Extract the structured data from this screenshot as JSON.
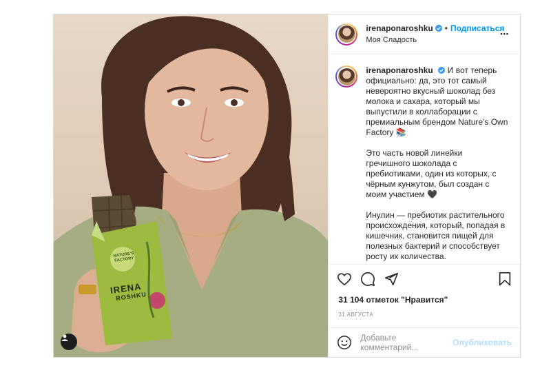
{
  "header": {
    "username": "irenaponaroshku",
    "separator": "•",
    "follow_label": "Подписаться",
    "location": "Моя Сладость",
    "more": "•••"
  },
  "caption": {
    "username": "irenaponaroshku",
    "paragraphs": [
      "И вот теперь официально: да, это тот самый невероятно вкусный шоколад без молока и сахара, который мы выпустили в коллаборации с премиальным брендом Nature's Own Factory 📚",
      "Это часть новой линейки гречишного шоколада с пребиотиками, один из которых, с чёрным кунжутом, был создан с моим участием 🖤",
      "Инулин — пребиотик растительного происхождения, который, попадая в кишечник, становится пищей для полезных бактерий и способствует росту их количества."
    ]
  },
  "photo": {
    "package_brand": "NATURE'S FACTORY",
    "package_name_1": "IRENA",
    "package_name_2": "ROSHKU"
  },
  "likes": "31 104 отметок \"Нравится\"",
  "date": "31 АВГУСТА",
  "comment": {
    "placeholder": "Добавьте комментарий...",
    "publish_label": "Опубликовать"
  },
  "icons": [
    "user-tag-icon",
    "heart-icon",
    "comment-icon",
    "share-icon",
    "bookmark-icon",
    "emoji-icon",
    "verified-icon",
    "more-icon"
  ],
  "colors": {
    "accent": "#0095f6",
    "verified": "#3897f0",
    "muted": "#8e8e8e"
  }
}
